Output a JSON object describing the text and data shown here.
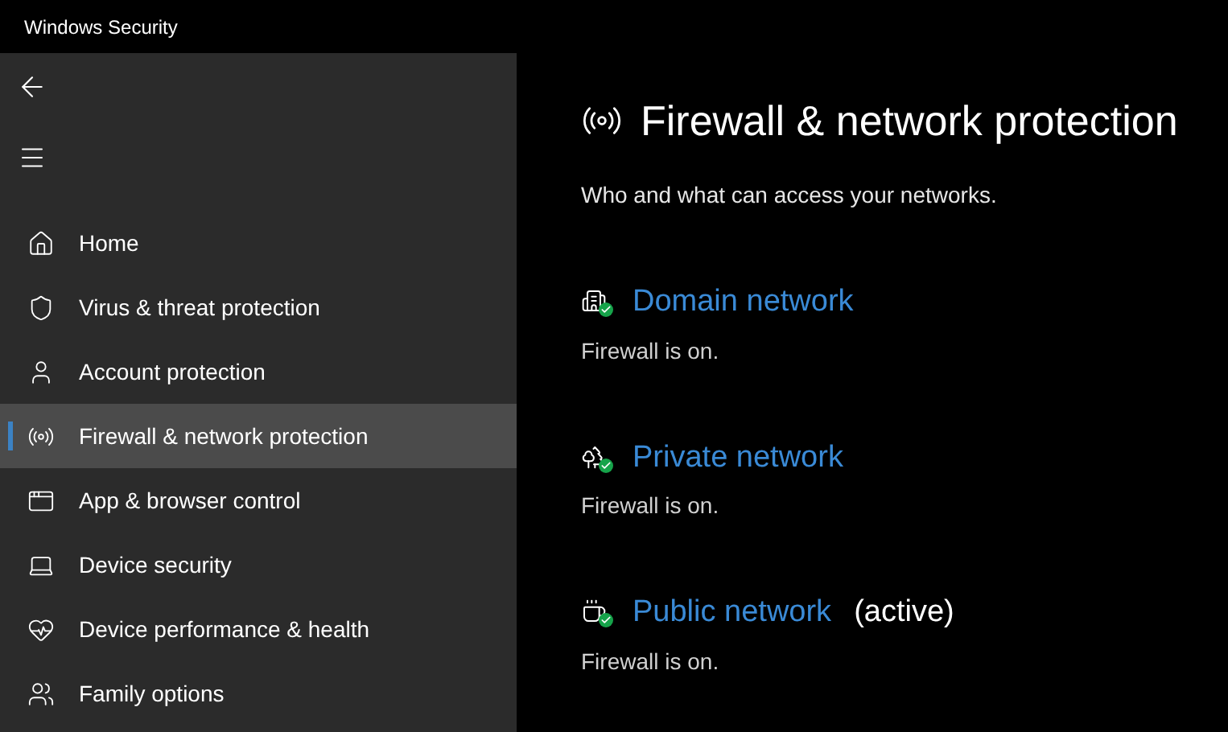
{
  "window": {
    "title": "Windows Security"
  },
  "sidebar": {
    "items": [
      {
        "kind": "home",
        "label": "Home",
        "selected": false
      },
      {
        "kind": "shield",
        "label": "Virus & threat protection",
        "selected": false
      },
      {
        "kind": "account",
        "label": "Account protection",
        "selected": false
      },
      {
        "kind": "firewall",
        "label": "Firewall & network protection",
        "selected": true
      },
      {
        "kind": "app",
        "label": "App & browser control",
        "selected": false
      },
      {
        "kind": "device",
        "label": "Device security",
        "selected": false
      },
      {
        "kind": "health",
        "label": "Device performance & health",
        "selected": false
      },
      {
        "kind": "family",
        "label": "Family options",
        "selected": false
      }
    ]
  },
  "page": {
    "title": "Firewall & network protection",
    "subtitle": "Who and what can access your networks.",
    "networks": [
      {
        "kind": "domain",
        "name": "Domain network",
        "status": "Firewall is on."
      },
      {
        "kind": "private",
        "name": "Private network",
        "status": "Firewall is on."
      },
      {
        "kind": "public",
        "name": "Public network",
        "active_label": "(active)",
        "status": "Firewall is on."
      }
    ]
  }
}
